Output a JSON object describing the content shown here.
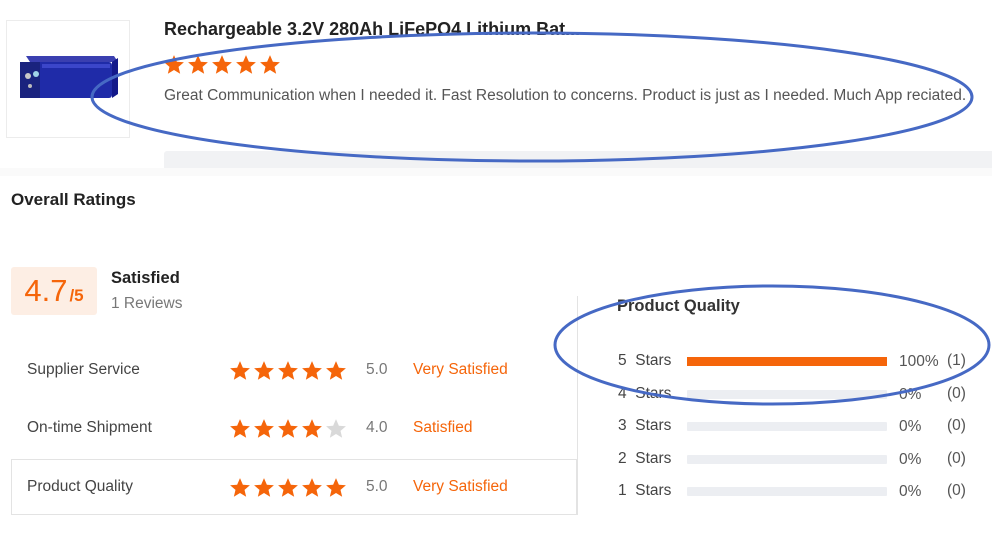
{
  "review": {
    "product_title": "Rechargeable 3.2V 280Ah LiFePO4 Lithium Bat...",
    "rating": 5,
    "text": "Great Communication when I needed it. Fast Resolution to concerns. Product is just as I needed. Much App reciated."
  },
  "overall": {
    "title": "Overall Ratings",
    "score": "4.7",
    "score_suffix": "/5",
    "label": "Satisfied",
    "reviews": "1 Reviews",
    "rows": [
      {
        "label": "Supplier Service",
        "stars": 5,
        "score": "5.0",
        "verdict": "Very Satisfied"
      },
      {
        "label": "On-time Shipment",
        "stars": 4,
        "score": "4.0",
        "verdict": "Satisfied"
      },
      {
        "label": "Product Quality",
        "stars": 5,
        "score": "5.0",
        "verdict": "Very Satisfied"
      }
    ]
  },
  "product_quality": {
    "title": "Product Quality",
    "bars": [
      {
        "label": "5  Stars",
        "fraction": 1.0,
        "pct": "100%",
        "count": "(1)"
      },
      {
        "label": "4  Stars",
        "fraction": 0.0,
        "pct": "0%",
        "count": "(0)"
      },
      {
        "label": "3  Stars",
        "fraction": 0.0,
        "pct": "0%",
        "count": "(0)"
      },
      {
        "label": "2  Stars",
        "fraction": 0.0,
        "pct": "0%",
        "count": "(0)"
      },
      {
        "label": "1  Stars",
        "fraction": 0.0,
        "pct": "0%",
        "count": "(0)"
      }
    ]
  },
  "colors": {
    "accent": "#f5650a",
    "star_empty": "#d9d9d9",
    "annotation": "#4669c4"
  },
  "icons": {
    "star": "star-icon",
    "product_image": "battery-product-image"
  }
}
